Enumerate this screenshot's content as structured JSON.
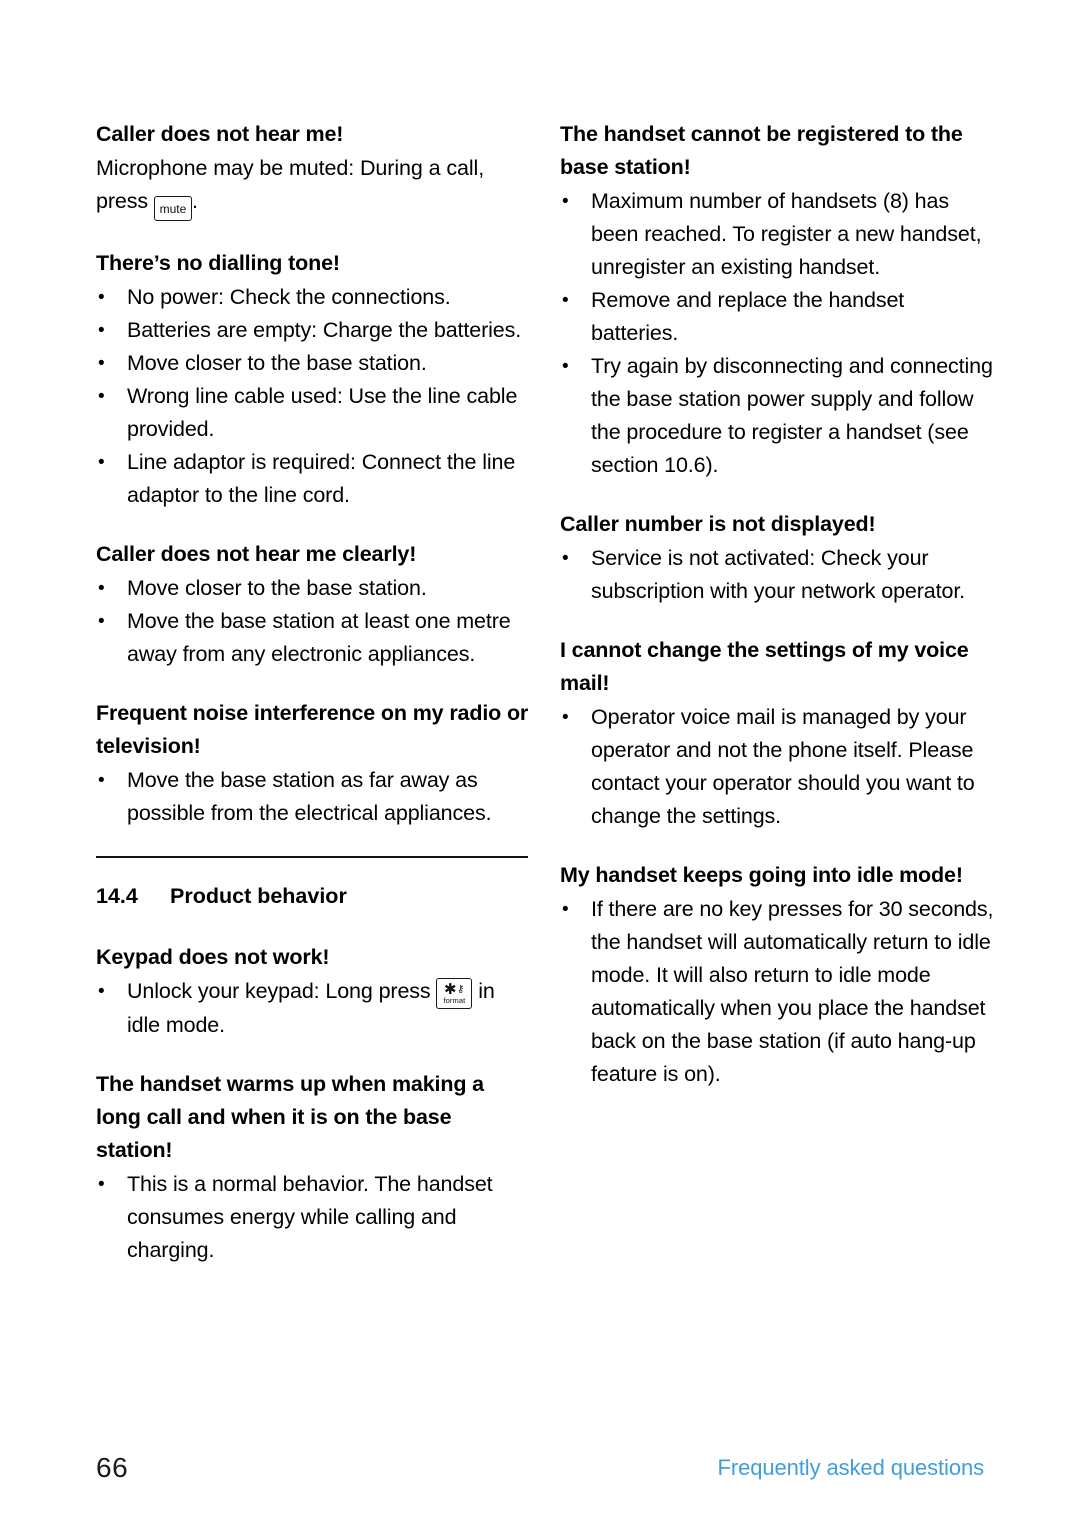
{
  "page": {
    "number": "66",
    "footer_label": "Frequently asked questions",
    "footer_color": "#3f9ede"
  },
  "left_column": {
    "blocks": [
      {
        "heading": "Caller does not hear me!",
        "body_before_key": "Microphone may be muted: During a call, press ",
        "key_label": "mute",
        "body_after_key": ".",
        "items": []
      },
      {
        "heading": "There’s no dialling tone!",
        "items": [
          "No power: Check the connections.",
          "Batteries are empty: Charge the batteries.",
          "Move closer to the base station.",
          "Wrong line cable used: Use the line cable provided.",
          "Line adaptor is required: Connect the line adaptor to the line cord."
        ]
      },
      {
        "heading": "Caller does not hear me clearly!",
        "items": [
          "Move closer to the base station.",
          "Move the base station at least one metre away from any electronic appliances."
        ]
      },
      {
        "heading": "Frequent noise interference on my radio or television!",
        "items": [
          "Move the base station as far away as possible from the electrical appliances."
        ]
      }
    ],
    "section": {
      "number": "14.4",
      "title": "Product behavior"
    },
    "blocks_after_section": [
      {
        "heading": "Keypad does not work!",
        "item_before_key": "Unlock your keypad: Long press ",
        "key_top_symbol": "✱",
        "key_top_symbol2": "⚷",
        "key_bottom_label": "format",
        "item_after_key": " in idle mode."
      },
      {
        "heading": "The handset warms up when making a long call and when it is on the base station!",
        "items": [
          "This is a normal behavior. The handset consumes energy while calling and charging."
        ]
      }
    ]
  },
  "right_column": {
    "blocks": [
      {
        "heading": "The handset cannot be registered to the base station!",
        "items": [
          "Maximum number of handsets (8) has been reached. To register a new handset, unregister an existing handset.",
          "Remove and replace the handset batteries.",
          "Try again by disconnecting and connecting the base station power supply and follow the procedure to register a handset (see section 10.6)."
        ]
      },
      {
        "heading": "Caller number is not displayed!",
        "items": [
          "Service is not activated: Check your subscription with your network operator."
        ]
      },
      {
        "heading": "I cannot change the settings of my voice mail!",
        "items": [
          "Operator voice mail is managed by your operator and not the phone itself. Please contact your operator should you want to change the settings."
        ]
      },
      {
        "heading": "My handset keeps going into idle mode!",
        "items": [
          "If there are no key presses for 30 seconds, the handset will automatically return to idle mode. It will also return to idle mode automatically when you place the handset back on the base station (if auto hang-up feature is on)."
        ]
      }
    ]
  }
}
